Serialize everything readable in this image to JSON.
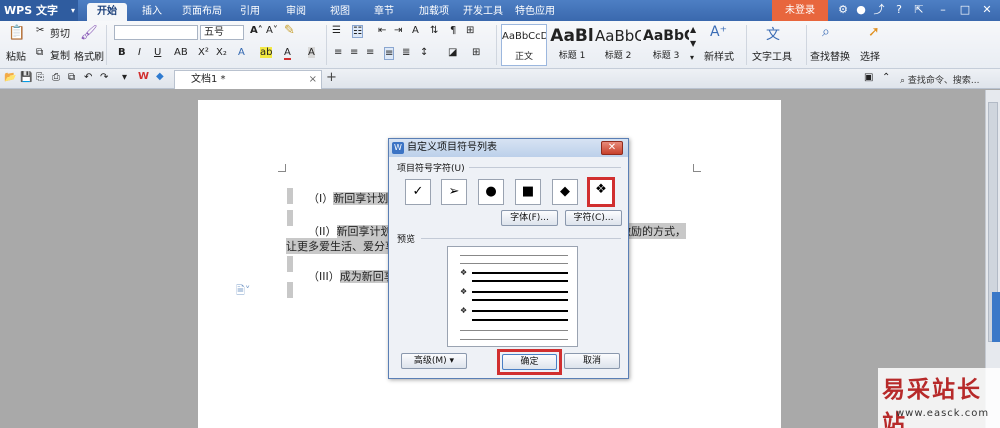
{
  "app": {
    "name": "WPS 文字",
    "menu_arrow": "▾"
  },
  "tabs": [
    "开始",
    "插入",
    "页面布局",
    "引用",
    "审阅",
    "视图",
    "章节",
    "加载项",
    "开发工具",
    "特色应用"
  ],
  "active_tab": "开始",
  "login_label": "未登录",
  "ribbon": {
    "paste": "粘贴",
    "cut": "剪切",
    "copy": "复制",
    "format_painter": "格式刷",
    "font_size": "五号",
    "styles": [
      {
        "sample": "AaBbCcDd",
        "name": "正文"
      },
      {
        "sample": "AaBl",
        "name": "标题 1"
      },
      {
        "sample": "AaBbC",
        "name": "标题 2"
      },
      {
        "sample": "AaBbC",
        "name": "标题 3"
      }
    ],
    "new_style": "新样式",
    "text_tools": "文字工具",
    "find_replace": "查找替换",
    "select": "选择"
  },
  "qabar": {
    "doc_tab": "文档1 *",
    "close": "×",
    "new_tab": "+",
    "search_placeholder": "查找命令、搜索..."
  },
  "document": {
    "line1_prefix": "（I）",
    "line1_text": "新回享计划是",
    "line2_prefix": "（II）",
    "line2_text": "新回享计划是",
    "line2_tail": "激励的方式，",
    "line3_text": "让更多爱生活、爱分享",
    "line4_prefix": "（III）",
    "line4_text": "成为新回享"
  },
  "dialog": {
    "title": "自定义项目符号列表",
    "close": "✕",
    "group_bullet_chars": "项目符号字符(U)",
    "bullets": [
      "✓",
      "➢",
      "●",
      "■",
      "◆",
      "❖"
    ],
    "selected_bullet_index": 5,
    "font_button": "字体(F)...",
    "char_button": "字符(C)...",
    "group_preview": "预览",
    "advanced_button": "高级(M) ▾",
    "ok_button": "确定",
    "cancel_button": "取消"
  },
  "watermark": {
    "title": "易采站长站",
    "url": "www.easck.com"
  },
  "colors": {
    "title_bar": "#3a68ad",
    "login": "#e8663d",
    "highlight_red": "#d12f2f"
  }
}
